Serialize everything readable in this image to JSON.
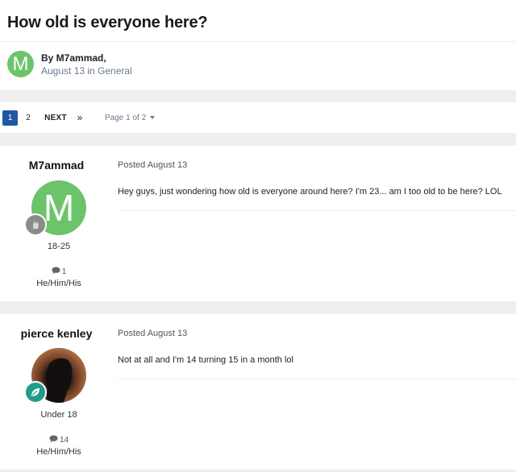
{
  "topic": {
    "title": "How old is everyone here?",
    "by_line": "By M7ammad,",
    "meta": "August 13 in General",
    "author_initial": "M"
  },
  "pagination": {
    "page1": "1",
    "page2": "2",
    "next": "NEXT",
    "last": "»",
    "page_of": "Page 1 of 2"
  },
  "posts": [
    {
      "author": "M7ammad",
      "avatar_initial": "M",
      "group": "18-25",
      "post_count": "1",
      "pronouns": "He/Him/His",
      "posted": "Posted August 13",
      "body": "Hey guys, just wondering how old is everyone around here? I'm 23... am I too old to be here? LOL"
    },
    {
      "author": "pierce kenley",
      "group": "Under 18",
      "post_count": "14",
      "pronouns": "He/Him/His",
      "posted": "Posted August 13",
      "body": "Not at all and I'm 14 turning 15 in a month lol"
    }
  ],
  "colors": {
    "accent": "#1f57a6",
    "avatar_green": "#6cc46a",
    "badge_teal": "#1e9e88"
  }
}
